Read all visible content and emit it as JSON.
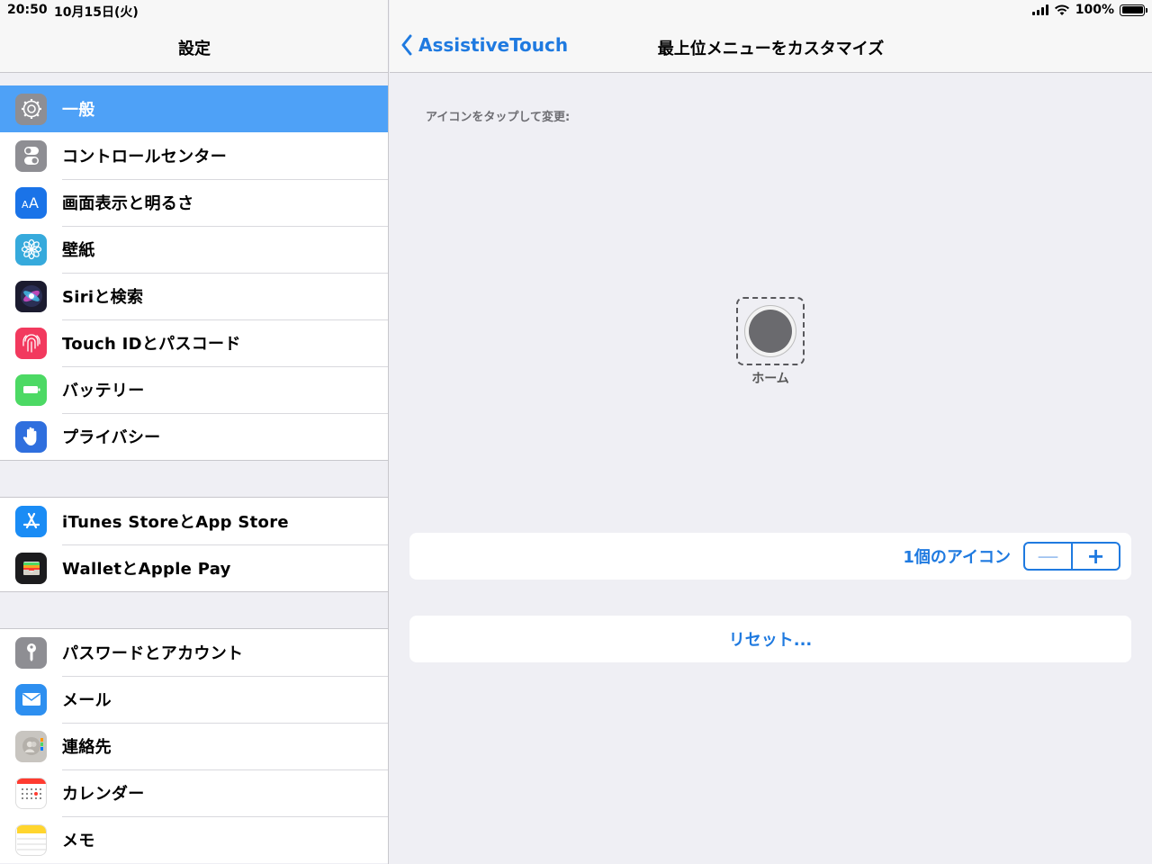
{
  "status_bar": {
    "time": "20:50",
    "date": "10月15日(火)",
    "battery": "100%"
  },
  "sidebar": {
    "title": "設定",
    "groups": [
      [
        {
          "label": "一般",
          "icon": "gear-icon",
          "color": "#8e8e93"
        },
        {
          "label": "コントロールセンター",
          "icon": "toggles-icon",
          "color": "#8e8e93"
        },
        {
          "label": "画面表示と明るさ",
          "icon": "text-size-icon",
          "color": "#1a73e8"
        },
        {
          "label": "壁紙",
          "icon": "flower-icon",
          "color": "#36aadc"
        },
        {
          "label": "Siriと検索",
          "icon": "siri-icon",
          "color": "#1b1b2f"
        },
        {
          "label": "Touch IDとパスコード",
          "icon": "fingerprint-icon",
          "color": "#f2395e"
        },
        {
          "label": "バッテリー",
          "icon": "battery-icon",
          "color": "#4cd964"
        },
        {
          "label": "プライバシー",
          "icon": "hand-icon",
          "color": "#2f6fde"
        }
      ],
      [
        {
          "label": "iTunes StoreとApp Store",
          "icon": "app-store-icon",
          "color": "#1a8cf5"
        },
        {
          "label": "WalletとApple Pay",
          "icon": "wallet-icon",
          "color": "#1c1c1e"
        }
      ],
      [
        {
          "label": "パスワードとアカウント",
          "icon": "key-icon",
          "color": "#8e8e93"
        },
        {
          "label": "メール",
          "icon": "mail-icon",
          "color": "#2d8ff0"
        },
        {
          "label": "連絡先",
          "icon": "contacts-icon",
          "color": "#c8c5c0"
        },
        {
          "label": "カレンダー",
          "icon": "calendar-icon",
          "color": "#ffffff"
        },
        {
          "label": "メモ",
          "icon": "notes-icon",
          "color": "#ffffff"
        }
      ]
    ]
  },
  "detail": {
    "back_label": "AssistiveTouch",
    "title": "最上位メニューをカスタマイズ",
    "hint": "アイコンをタップして変更:",
    "home_label": "ホーム",
    "count_label": "1個のアイコン",
    "minus": "—",
    "plus": "+",
    "reset_label": "リセット..."
  },
  "accent_color": "#1f7ae0"
}
